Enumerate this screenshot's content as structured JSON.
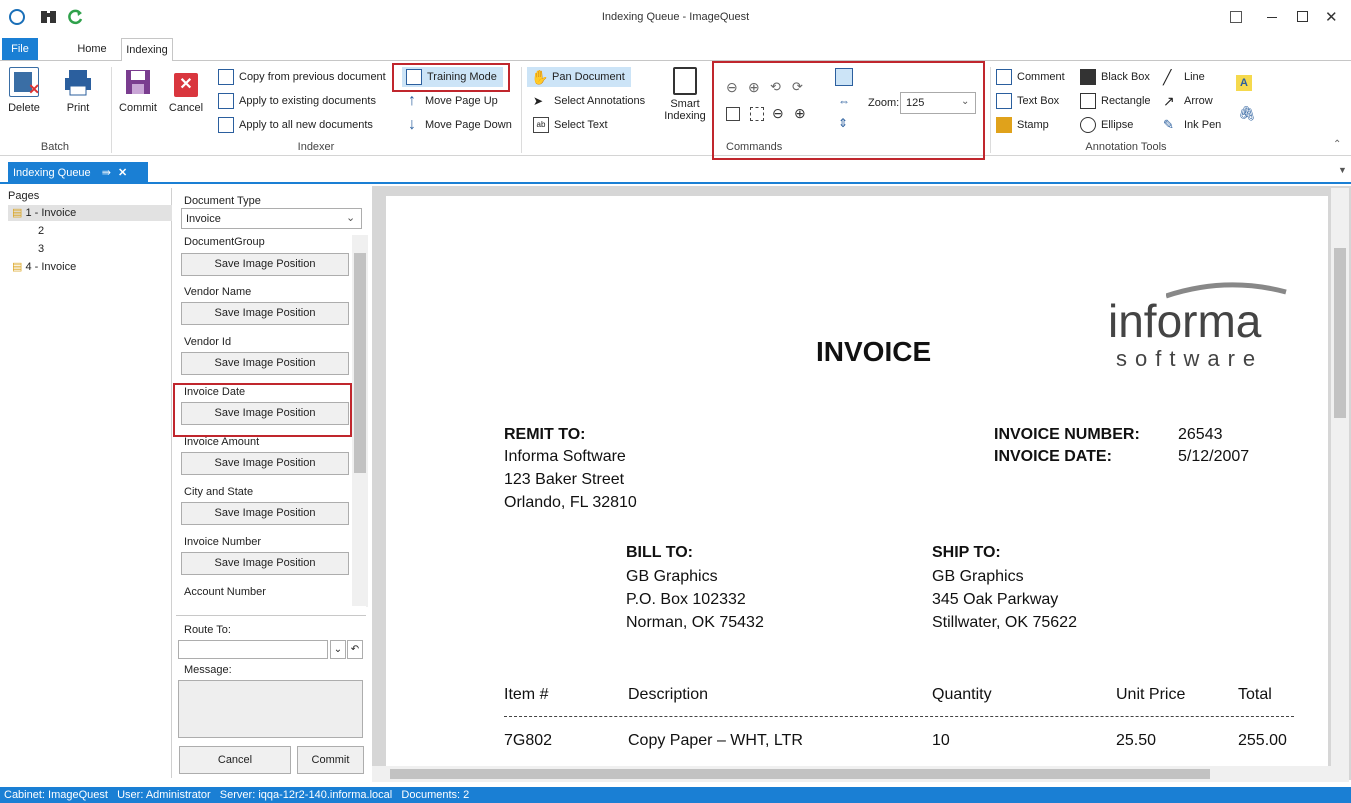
{
  "window": {
    "title": "Indexing Queue - ImageQuest"
  },
  "ribbon_tabs": [
    "File",
    "Home",
    "Indexing"
  ],
  "batch": {
    "label": "Batch",
    "delete": "Delete",
    "print": "Print"
  },
  "indexer": {
    "label": "Indexer",
    "commit": "Commit",
    "cancel": "Cancel",
    "copy_prev": "Copy from previous document",
    "apply_existing": "Apply to existing documents",
    "apply_new": "Apply to all new documents",
    "training": "Training Mode",
    "move_up": "Move Page Up",
    "move_down": "Move Page Down"
  },
  "nav": {
    "pan": "Pan Document",
    "select_ann": "Select Annotations",
    "select_text": "Select Text",
    "smart1": "Smart",
    "smart2": "Indexing"
  },
  "commands": {
    "label": "Commands",
    "zoom_label": "Zoom:",
    "zoom_value": "125"
  },
  "annotations": {
    "label": "Annotation Tools",
    "comment": "Comment",
    "text_box": "Text Box",
    "stamp": "Stamp",
    "black_box": "Black Box",
    "rectangle": "Rectangle",
    "ellipse": "Ellipse",
    "line": "Line",
    "arrow": "Arrow",
    "ink_pen": "Ink Pen"
  },
  "doc_tab": {
    "label": "Indexing Queue"
  },
  "pages": {
    "header": "Pages",
    "items": [
      "1 - Invoice",
      "2",
      "3",
      "4 - Invoice"
    ]
  },
  "fields": {
    "doc_type_label": "Document Type",
    "doc_type_value": "Invoice",
    "save_label": "Save Image Position",
    "names": [
      "DocumentGroup",
      "Vendor Name",
      "Vendor Id",
      "Invoice Date",
      "Invoice Amount",
      "City and State",
      "Invoice Number",
      "Account Number"
    ],
    "route_to": "Route To:",
    "message": "Message:",
    "cancel": "Cancel",
    "commit": "Commit"
  },
  "invoice": {
    "title": "INVOICE",
    "logo_main": "informa",
    "logo_sub": "software",
    "remit_label": "REMIT TO:",
    "remit_lines": [
      "Informa Software",
      "123 Baker Street",
      "Orlando, FL  32810"
    ],
    "num_label": "INVOICE NUMBER:",
    "num_value": "26543",
    "date_label": "INVOICE DATE:",
    "date_value": "5/12/2007",
    "bill_label": "BILL TO:",
    "bill_lines": [
      "GB Graphics",
      "P.O. Box 102332",
      "Norman, OK  75432"
    ],
    "ship_label": "SHIP TO:",
    "ship_lines": [
      "GB Graphics",
      "345 Oak Parkway",
      "Stillwater, OK  75622"
    ],
    "headers": [
      "Item #",
      "Description",
      "Quantity",
      "Unit Price",
      "Total"
    ],
    "row1": [
      "7G802",
      "Copy Paper – WHT, LTR",
      "10",
      "25.50",
      "255.00"
    ]
  },
  "status": {
    "text": "Cabinet: ImageQuest   User: Administrator   Server: iqqa-12r2-140.informa.local   Documents: 2"
  },
  "colors": {
    "accent": "#1a7fd4",
    "highlight_box": "#c0262d",
    "selected_btn": "#cce4f7"
  }
}
